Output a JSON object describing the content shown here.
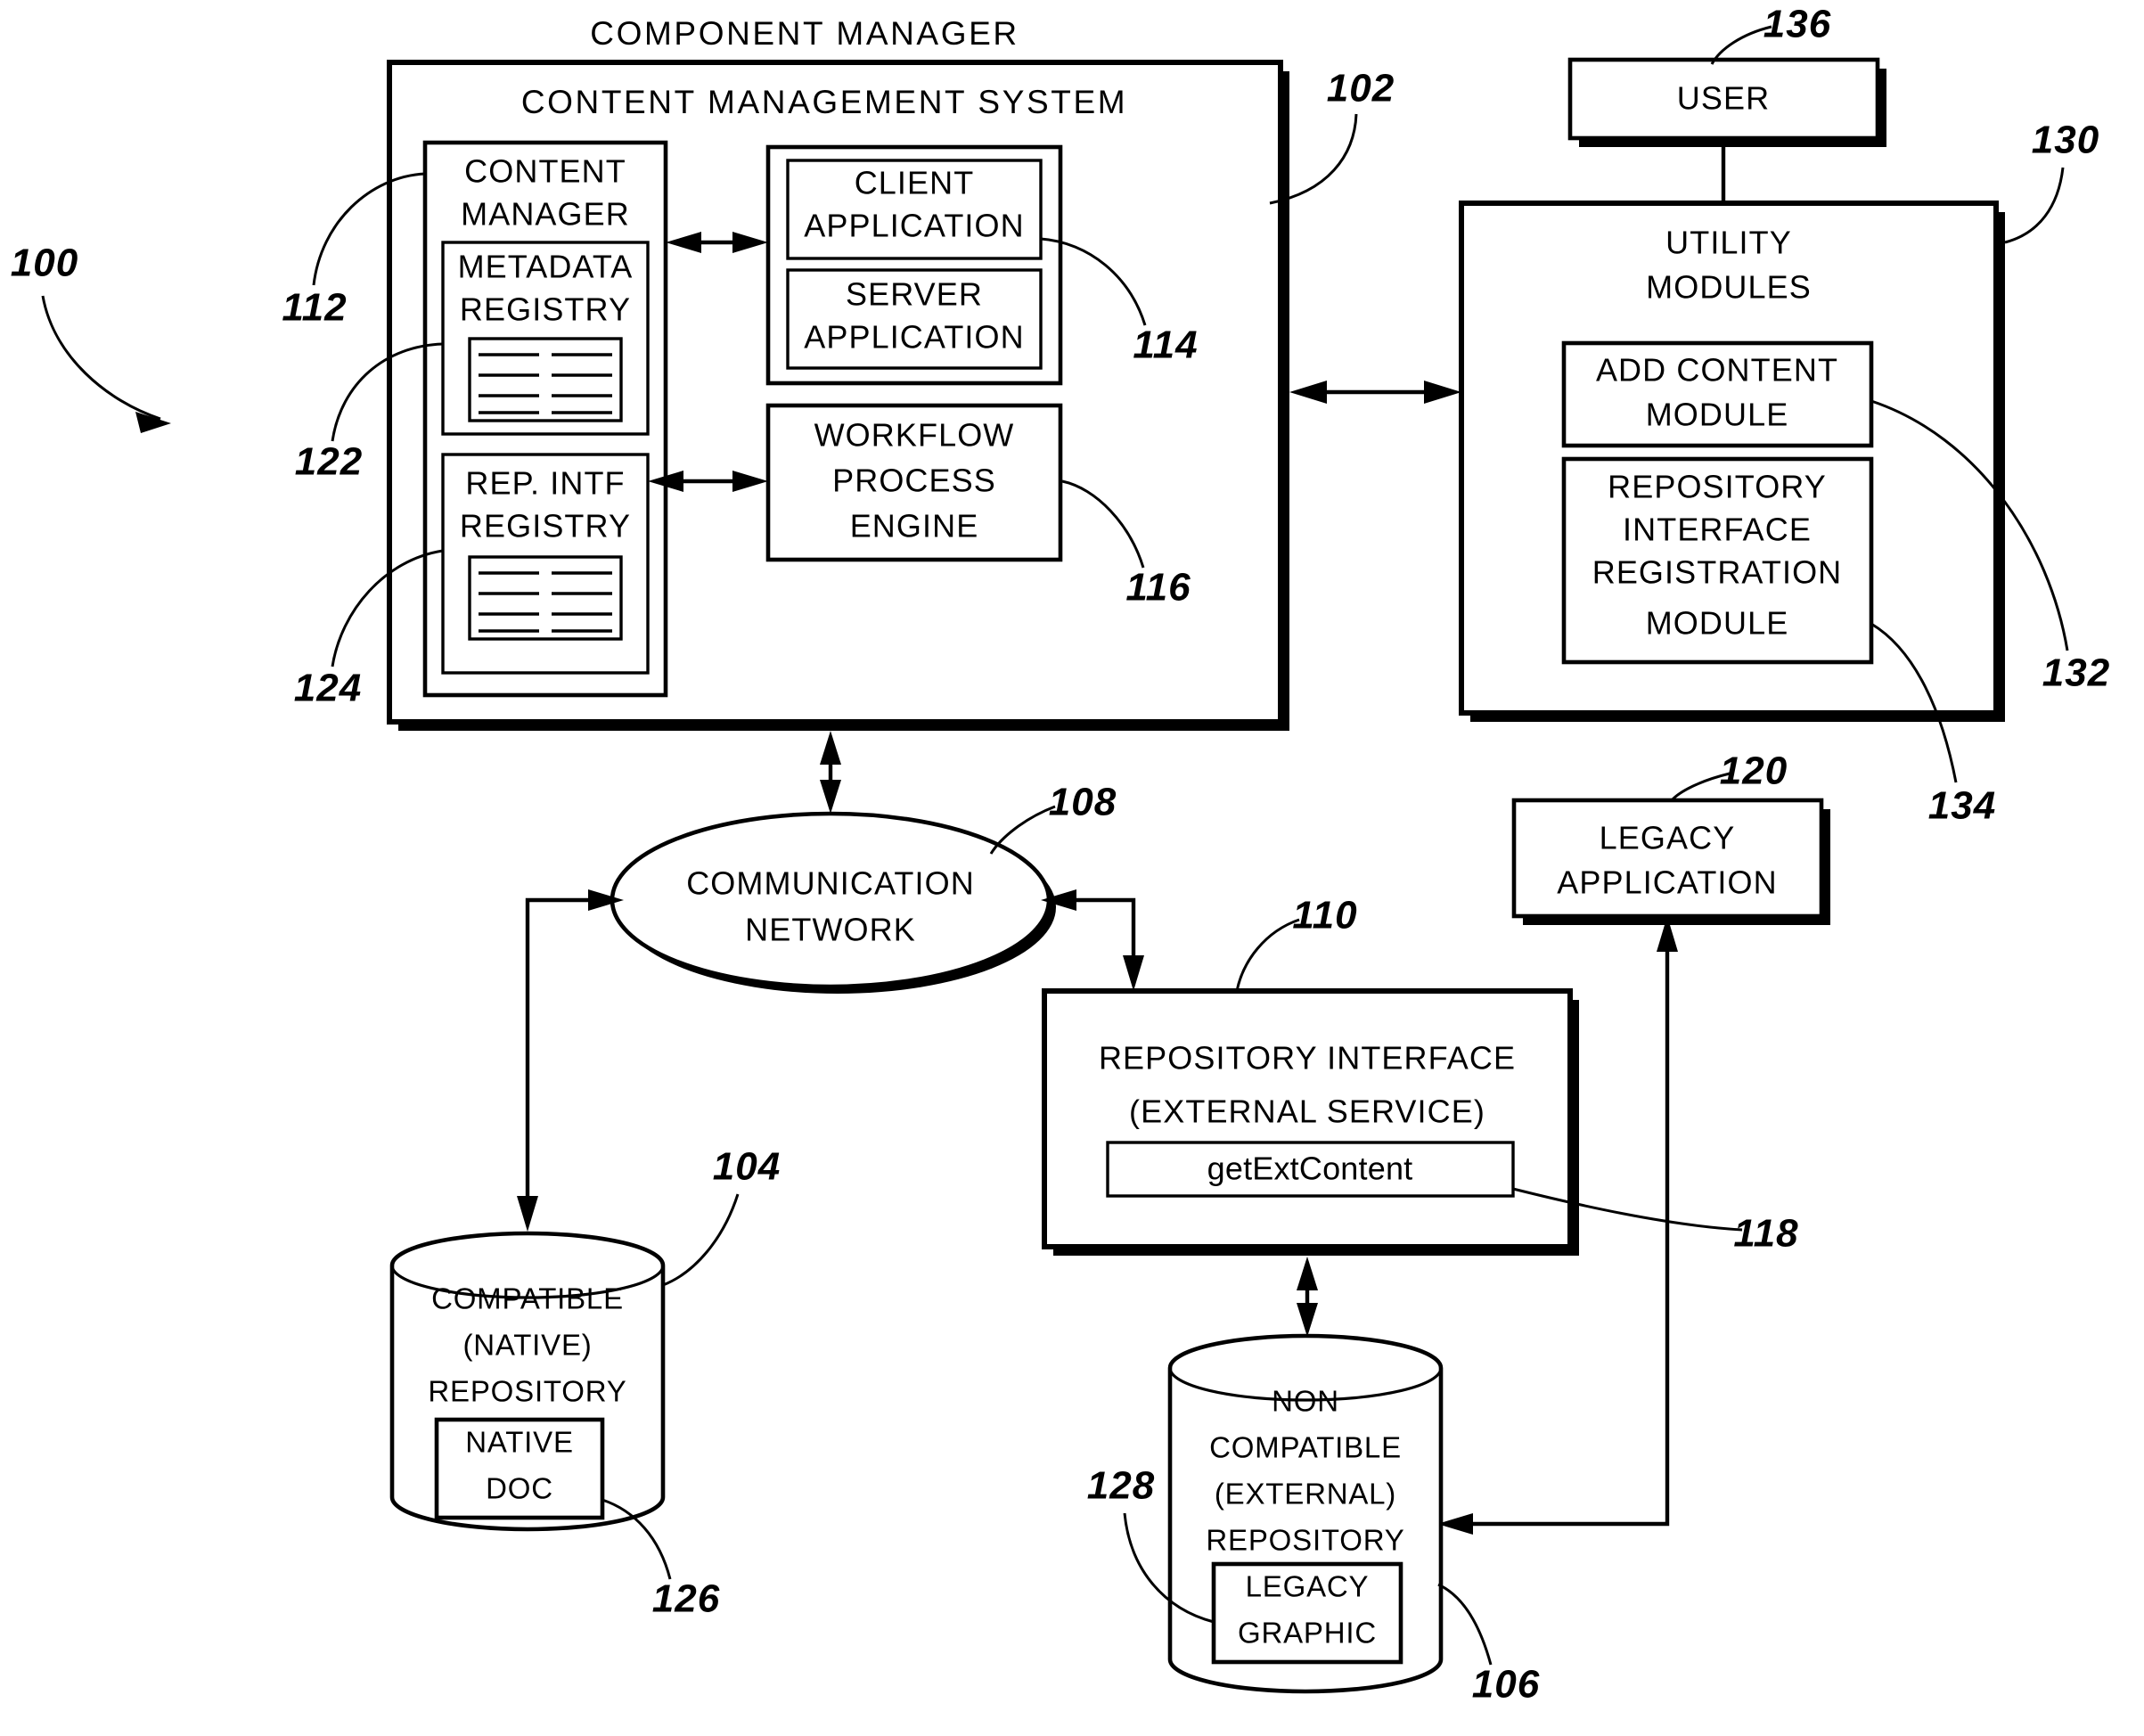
{
  "figure": {
    "title": "COMPONENT MANAGER",
    "cms_title": "CONTENT MANAGEMENT SYSTEM"
  },
  "blocks": {
    "content_manager": {
      "line1": "CONTENT",
      "line2": "MANAGER"
    },
    "metadata_registry": {
      "line1": "METADATA",
      "line2": "REGISTRY",
      "icon": "registry-table-icon"
    },
    "rep_intf_registry": {
      "line1": "REP.  INTF",
      "line2": "REGISTRY",
      "icon": "registry-table-icon"
    },
    "client_application": {
      "line1": "CLIENT",
      "line2": "APPLICATION"
    },
    "server_application": {
      "line1": "SERVER",
      "line2": "APPLICATION"
    },
    "workflow_process_engine": {
      "line1": "WORKFLOW",
      "line2": "PROCESS",
      "line3": "ENGINE"
    },
    "user": {
      "label": "USER"
    },
    "utility_modules": {
      "line1": "UTILITY",
      "line2": "MODULES"
    },
    "add_content_module": {
      "line1": "ADD  CONTENT",
      "line2": "MODULE"
    },
    "repository_interface_registration_module": {
      "line1": "REPOSITORY",
      "line2": "INTERFACE",
      "line3": "REGISTRATION",
      "line4": "MODULE"
    },
    "legacy_application": {
      "line1": "LEGACY",
      "line2": "APPLICATION"
    },
    "communication_network": {
      "line1": "COMMUNICATION",
      "line2": "NETWORK"
    },
    "repository_interface": {
      "line1": "REPOSITORY  INTERFACE",
      "line2": "(EXTERNAL  SERVICE)"
    },
    "get_ext_content": {
      "label": "getExtContent"
    },
    "compatible_repository": {
      "line1": "COMPATIBLE",
      "line2": "(NATIVE)",
      "line3": "REPOSITORY"
    },
    "native_doc": {
      "line1": "NATIVE",
      "line2": "DOC"
    },
    "noncompatible_repository": {
      "line1": "NON",
      "line2": "COMPATIBLE",
      "line3": "(EXTERNAL)",
      "line4": "REPOSITORY"
    },
    "legacy_graphic": {
      "line1": "LEGACY",
      "line2": "GRAPHIC"
    }
  },
  "reference_numerals": {
    "n100": "100",
    "n102": "102",
    "n104": "104",
    "n106": "106",
    "n108": "108",
    "n110": "110",
    "n112": "112",
    "n114": "114",
    "n116": "116",
    "n118": "118",
    "n120": "120",
    "n122": "122",
    "n124": "124",
    "n126": "126",
    "n128": "128",
    "n130": "130",
    "n132": "132",
    "n134": "134",
    "n136": "136"
  },
  "colors": {
    "ink": "#000000",
    "paper": "#ffffff"
  }
}
